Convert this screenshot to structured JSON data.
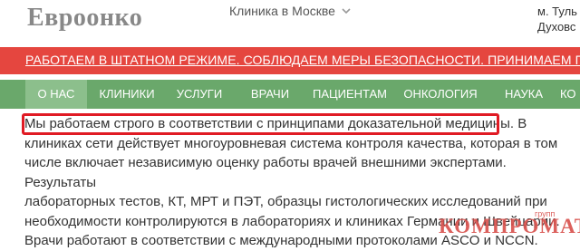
{
  "header": {
    "logo": "Евроонко",
    "city_label": "Клиника в Москве",
    "metro_line1": "м. Туль",
    "metro_line2": "Духовс"
  },
  "banner": {
    "text": "РАБОТАЕМ В ШТАТНОМ РЕЖИМЕ. СОБЛЮДАЕМ МЕРЫ БЕЗОПАСНОСТИ. ПРИНИМАЕМ ПАЦИЕНТОВ СО ВСЕГО МИРА"
  },
  "nav": {
    "items": [
      {
        "label": "О НАС"
      },
      {
        "label": "КЛИНИКИ"
      },
      {
        "label": "УСЛУГИ"
      },
      {
        "label": "ВРАЧИ"
      },
      {
        "label": "ПАЦИЕНТАМ"
      },
      {
        "label": "ОНКОЛОГИЯ"
      },
      {
        "label": "НАУКА"
      },
      {
        "label": "КО"
      }
    ]
  },
  "content": {
    "line1_a": "Мы работаем строго в соответствии с ",
    "line1_link": "принципами доказательной медицины",
    "line1_b": ". В",
    "line2": "клиниках сети действует многоуровневая система контроля качества, которая в том",
    "line3": "числе включает независимую оценку работы врачей внешними экспертами. Результаты",
    "line4": "лабораторных тестов, КТ, МРТ и ПЭТ, образцы гистологических исследований при",
    "line5": "необходимости контролируются в лабораториях и клиниках Германии и Швейцарии.",
    "line6": "Врачи работают в соответствии с международными протоколами ASCO и NCCN."
  },
  "watermark": {
    "main": "КОМПРОМАТ",
    "small": "групп"
  },
  "colors": {
    "banner": "#e5463f",
    "nav": "#6aa86b",
    "nav_active": "#8cbf8c",
    "highlight": "#e01b24"
  }
}
